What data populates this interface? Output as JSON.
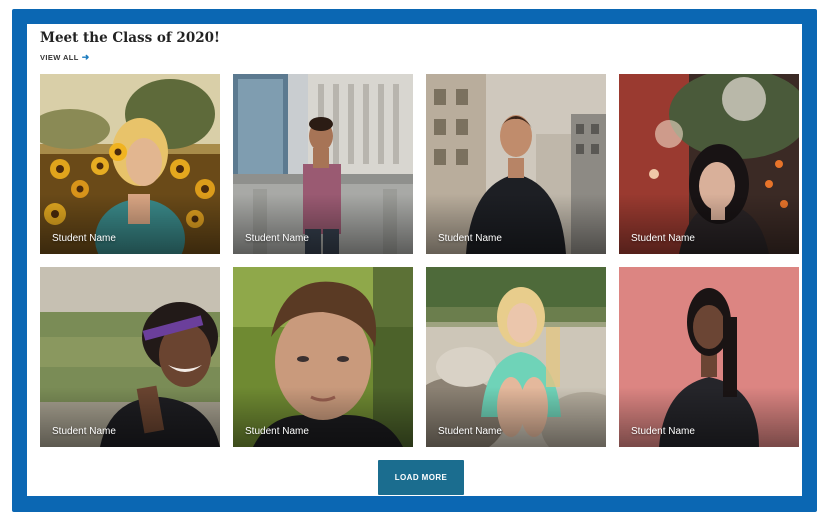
{
  "section": {
    "title": "Meet the Class of 2020!",
    "view_all_label": "VIEW ALL",
    "view_all_icon": "arrow-right-icon",
    "accent_color": "#0b67b3",
    "button_color": "#1b6d8f"
  },
  "students": [
    {
      "name": "Student Name"
    },
    {
      "name": "Student Name"
    },
    {
      "name": "Student Name"
    },
    {
      "name": "Student Name"
    },
    {
      "name": "Student Name"
    },
    {
      "name": "Student Name"
    },
    {
      "name": "Student Name"
    },
    {
      "name": "Student Name"
    }
  ],
  "actions": {
    "load_more_label": "LOAD MORE"
  }
}
